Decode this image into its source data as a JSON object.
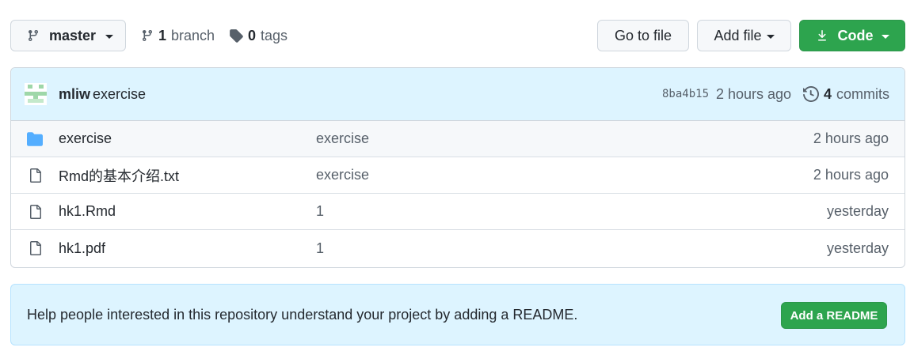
{
  "toolbar": {
    "branch_name": "master",
    "branches_count": "1",
    "branches_label": "branch",
    "tags_count": "0",
    "tags_label": "tags",
    "go_to_file": "Go to file",
    "add_file": "Add file",
    "code": "Code"
  },
  "latest_commit": {
    "author": "mliw",
    "message": "exercise",
    "sha": "8ba4b15",
    "time": "2 hours ago",
    "commits_count": "4",
    "commits_label": "commits"
  },
  "files": [
    {
      "type": "folder",
      "name": "exercise",
      "commit": "exercise",
      "time": "2 hours ago"
    },
    {
      "type": "file",
      "name": "Rmd的基本介绍.txt",
      "commit": "exercise",
      "time": "2 hours ago"
    },
    {
      "type": "file",
      "name": "hk1.Rmd",
      "commit": "1",
      "time": "yesterday"
    },
    {
      "type": "file",
      "name": "hk1.pdf",
      "commit": "1",
      "time": "yesterday"
    }
  ],
  "readme_banner": {
    "text": "Help people interested in this repository understand your project by adding a README.",
    "button": "Add a README"
  },
  "colors": {
    "primary_green": "#2da44e",
    "folder_blue": "#54aeff",
    "banner_bg": "#ddf4ff"
  }
}
